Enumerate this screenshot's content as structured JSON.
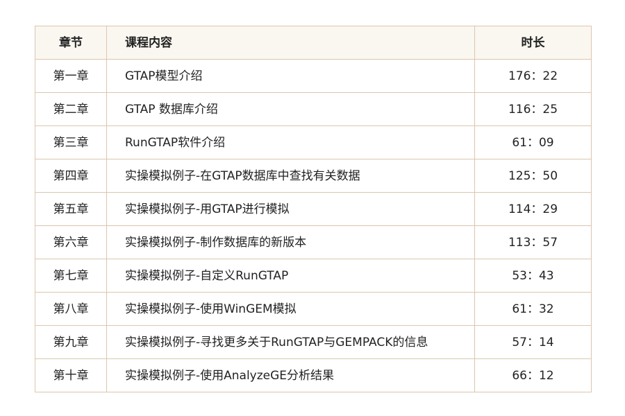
{
  "table": {
    "headers": {
      "chapter": "章节",
      "content": "课程内容",
      "duration": "时长"
    },
    "rows": [
      {
        "chapter": "第一章",
        "content": "GTAP模型介绍",
        "duration": "176：22"
      },
      {
        "chapter": "第二章",
        "content": "GTAP 数据库介绍",
        "duration": "116：25"
      },
      {
        "chapter": "第三章",
        "content": "RunGTAP软件介绍",
        "duration": "61：09"
      },
      {
        "chapter": "第四章",
        "content": "实操模拟例子-在GTAP数据库中查找有关数据",
        "duration": "125：50"
      },
      {
        "chapter": "第五章",
        "content": "实操模拟例子-用GTAP进行模拟",
        "duration": "114：29"
      },
      {
        "chapter": "第六章",
        "content": "实操模拟例子-制作数据库的新版本",
        "duration": "113：57"
      },
      {
        "chapter": "第七章",
        "content": "实操模拟例子-自定义RunGTAP",
        "duration": "53：43"
      },
      {
        "chapter": "第八章",
        "content": "实操模拟例子-使用WinGEM模拟",
        "duration": "61：32"
      },
      {
        "chapter": "第九章",
        "content": "实操模拟例子-寻找更多关于RunGTAP与GEMPACK的信息",
        "duration": "57：14"
      },
      {
        "chapter": "第十章",
        "content": "实操模拟例子-使用AnalyzeGE分析结果",
        "duration": "66：12"
      }
    ]
  },
  "colors": {
    "border": "#dcc6ad",
    "header_bg": "#faf7f0",
    "text": "#222222"
  }
}
